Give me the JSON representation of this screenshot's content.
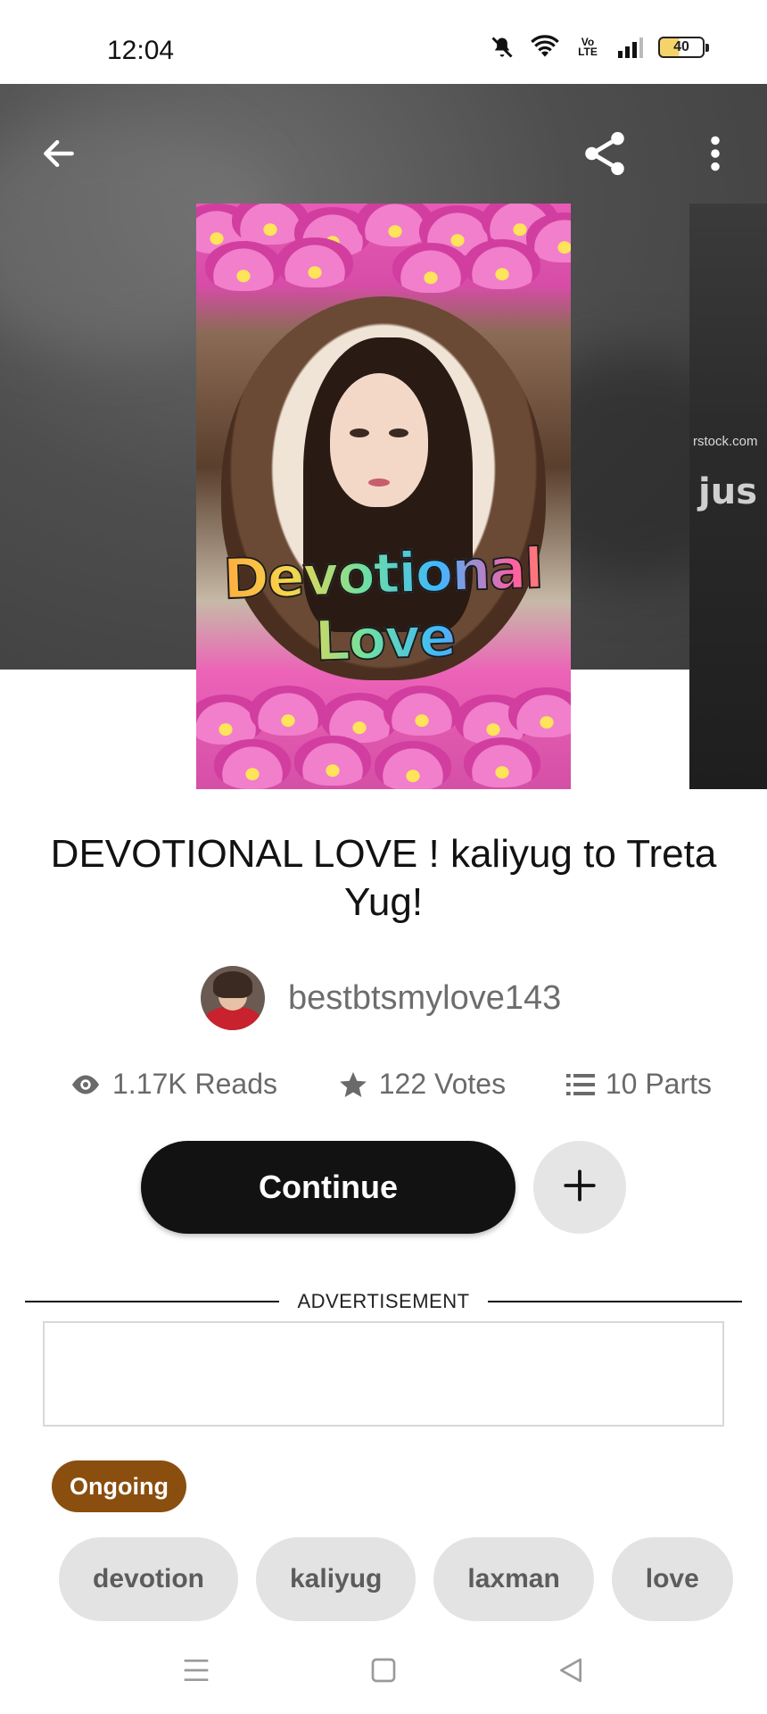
{
  "status_bar": {
    "time": "12:04",
    "network_label": "Vo\nLTE",
    "battery_level": "40",
    "icons": [
      "mute-icon",
      "wifi-icon",
      "signal-icon",
      "battery-icon"
    ]
  },
  "header": {
    "icons": [
      "arrow-left-icon",
      "share-icon",
      "more-vertical-icon"
    ]
  },
  "cover": {
    "title_art": "Devotional Love",
    "next_cover_watermark": "rstock.com",
    "next_cover_text": "jus"
  },
  "story": {
    "title": "DEVOTIONAL LOVE ! kaliyug to Treta Yug!",
    "author": "bestbtsmylove143"
  },
  "stats": {
    "reads": "1.17K Reads",
    "votes": "122 Votes",
    "parts": "10 Parts"
  },
  "actions": {
    "continue_label": "Continue",
    "add_icon": "plus-icon"
  },
  "ad": {
    "label": "ADVERTISEMENT"
  },
  "status_badge": "Ongoing",
  "tags": [
    "devotion",
    "kaliyug",
    "laxman",
    "love"
  ],
  "colors": {
    "badge": "#8a4e0f",
    "primary_button": "#121212",
    "tag_bg": "#e3e3e3"
  },
  "nav": {
    "icons": [
      "menu-icon",
      "home-square-icon",
      "back-triangle-icon"
    ]
  }
}
